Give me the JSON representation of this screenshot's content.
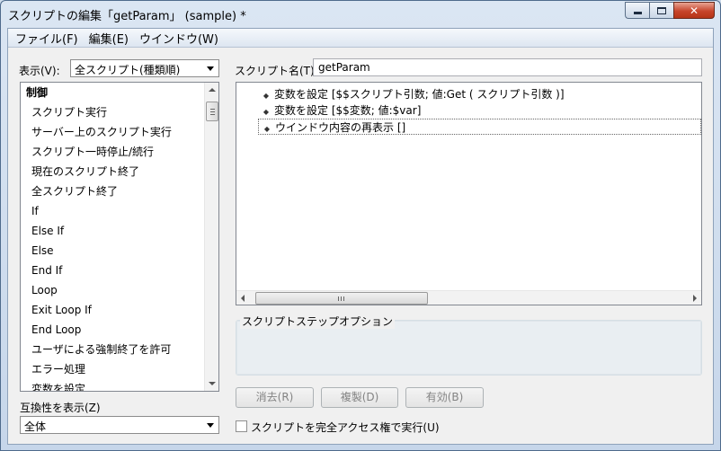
{
  "window": {
    "title": "スクリプトの編集「getParam」 (sample) *"
  },
  "menu": {
    "file": "ファイル(F)",
    "edit": "編集(E)",
    "window": "ウインドウ(W)"
  },
  "left_panel": {
    "view_label": "表示(V):",
    "view_value": "全スクリプト(種類順)",
    "items": [
      "制御",
      "スクリプト実行",
      "サーバー上のスクリプト実行",
      "スクリプト一時停止/続行",
      "現在のスクリプト終了",
      "全スクリプト終了",
      "If",
      "Else If",
      "Else",
      "End If",
      "Loop",
      "Exit Loop If",
      "End Loop",
      "ユーザによる強制終了を許可",
      "エラー処理",
      "変数を設定"
    ],
    "compat_label": "互換性を表示(Z)",
    "compat_value": "全体"
  },
  "right_panel": {
    "script_name_label": "スクリプト名(T):",
    "script_name_value": "getParam",
    "steps": [
      "変数を設定 [$$スクリプト引数; 値:Get ( スクリプト引数 )]",
      "変数を設定 [$$変数; 値:$var]",
      "ウインドウ内容の再表示 []"
    ],
    "options_group_title": "スクリプトステップオプション",
    "buttons": {
      "clear": "消去(R)",
      "duplicate": "複製(D)",
      "enable": "有効(B)"
    },
    "full_access_label": "スクリプトを完全アクセス権で実行(U)"
  }
}
